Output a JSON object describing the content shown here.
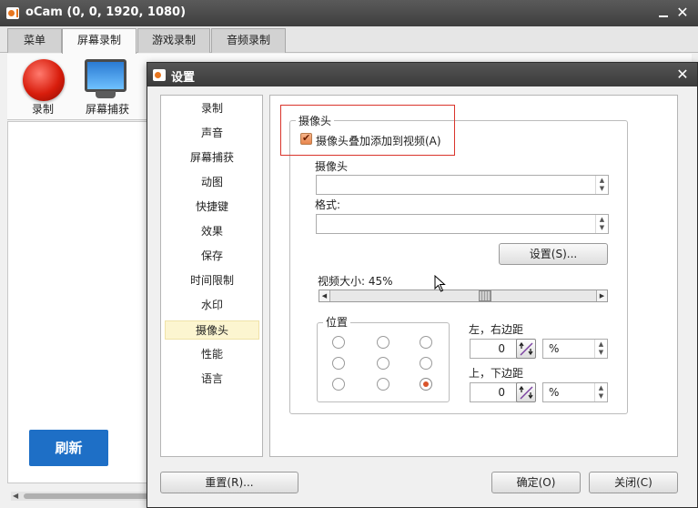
{
  "main_window": {
    "title": "oCam (0, 0, 1920, 1080)",
    "close_glyph": "✕",
    "tabs": [
      {
        "label": "菜单"
      },
      {
        "label": "屏幕录制"
      },
      {
        "label": "游戏录制"
      },
      {
        "label": "音频录制"
      }
    ],
    "active_tab": "屏幕录制",
    "ribbon": {
      "record_label": "录制",
      "capture_label": "屏幕捕获"
    },
    "refresh_label": "刷新"
  },
  "dialog": {
    "title": "设置",
    "close_glyph": "✕",
    "nav_items": [
      {
        "label": "录制"
      },
      {
        "label": "声音"
      },
      {
        "label": "屏幕捕获"
      },
      {
        "label": "动图"
      },
      {
        "label": "快捷键"
      },
      {
        "label": "效果"
      },
      {
        "label": "保存"
      },
      {
        "label": "时间限制"
      },
      {
        "label": "水印"
      },
      {
        "label": "摄像头"
      },
      {
        "label": "性能"
      },
      {
        "label": "语言"
      }
    ],
    "selected_nav": "摄像头",
    "webcam": {
      "group_title": "摄像头",
      "overlay_checkbox_label": "摄像头叠加添加到视频(A)",
      "overlay_checked": true,
      "camera_label": "摄像头",
      "camera_value": "",
      "format_label": "格式:",
      "format_value": "",
      "settings_button": "设置(S)...",
      "video_size_label": "视频大小: 45%",
      "video_size_percent": 45,
      "position_title": "位置",
      "selected_position": "bottom-right",
      "lr_margin_label": "左，右边距",
      "lr_margin_value": "0",
      "lr_unit": "%",
      "tb_margin_label": "上，下边距",
      "tb_margin_value": "0",
      "tb_unit": "%"
    },
    "buttons": {
      "reset": "重置(R)...",
      "ok": "确定(O)",
      "close": "关闭(C)"
    }
  },
  "colors": {
    "accent_blue": "#1e6fc6",
    "highlight_red": "#d9342b",
    "radio_selected": "#d9542b"
  }
}
